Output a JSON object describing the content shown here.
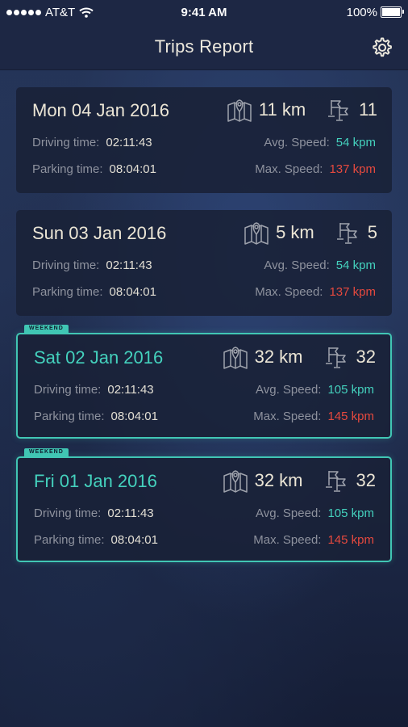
{
  "status_bar": {
    "carrier": "AT&T",
    "time": "9:41 AM",
    "battery": "100%"
  },
  "header": {
    "title": "Trips Report"
  },
  "labels": {
    "driving_time": "Driving time:",
    "parking_time": "Parking time:",
    "avg_speed": "Avg. Speed:",
    "max_speed": "Max. Speed:",
    "weekend": "WEEKEND"
  },
  "trips": [
    {
      "date": "Mon 04 Jan 2016",
      "distance": "11 km",
      "stops": "11",
      "driving_time": "02:11:43",
      "parking_time": "08:04:01",
      "avg_speed": "54 kpm",
      "max_speed": "137 kpm",
      "weekend": false
    },
    {
      "date": "Sun 03 Jan 2016",
      "distance": "5 km",
      "stops": "5",
      "driving_time": "02:11:43",
      "parking_time": "08:04:01",
      "avg_speed": "54 kpm",
      "max_speed": "137 kpm",
      "weekend": false
    },
    {
      "date": "Sat 02 Jan 2016",
      "distance": "32 km",
      "stops": "32",
      "driving_time": "02:11:43",
      "parking_time": "08:04:01",
      "avg_speed": "105 kpm",
      "max_speed": "145 kpm",
      "weekend": true
    },
    {
      "date": "Fri 01 Jan 2016",
      "distance": "32 km",
      "stops": "32",
      "driving_time": "02:11:43",
      "parking_time": "08:04:01",
      "avg_speed": "105 kpm",
      "max_speed": "145 kpm",
      "weekend": true
    }
  ],
  "icons": {
    "settings": "gear-icon",
    "distance": "map-pin-icon",
    "stops": "flags-icon",
    "signal": "signal-dots-icon",
    "wifi": "wifi-icon",
    "battery": "battery-icon"
  },
  "colors": {
    "accent": "#44d1bd",
    "danger": "#e5493e",
    "card_bg": "#192137",
    "nav_bg": "#1d2744"
  }
}
